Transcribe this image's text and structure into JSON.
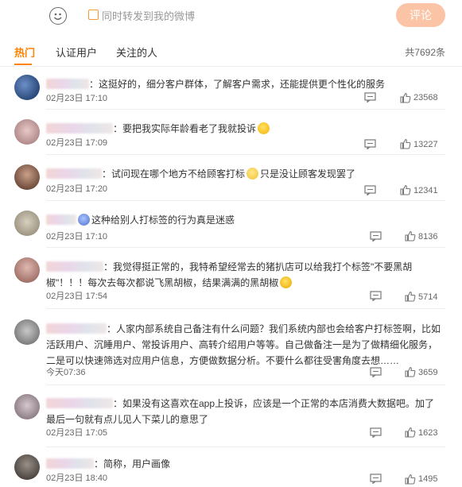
{
  "composer": {
    "emoji_icon": "smiley-icon",
    "repost_label": "同时转发到我的微博",
    "submit_label": "评论",
    "accent": "#ff8200",
    "submit_color": "#fbc4a6"
  },
  "tabs": [
    {
      "label": "热门",
      "active": true
    },
    {
      "label": "认证用户",
      "active": false
    },
    {
      "label": "关注的人",
      "active": false
    }
  ],
  "total_label": "共7692条",
  "comments": [
    {
      "name": "",
      "text": "：这挺好的，细分客户群体，了解客户需求，还能提供更个性化的服务",
      "time": "02月23日 17:10",
      "likes": "23568"
    },
    {
      "name": "",
      "text": "：要把我实际年龄看老了我就投诉",
      "time": "02月23日 17:09",
      "likes": "13227",
      "emoji": "grin-emoji"
    },
    {
      "name": "",
      "text": "：试问现在哪个地方不给顾客打标",
      "text_after": "只是没让顾客发现罢了",
      "time": "02月23日 17:20",
      "likes": "12341",
      "emoji": "grimace-emoji"
    },
    {
      "name": "",
      "text": "这种给别人打标签的行为真是迷惑",
      "time": "02月23日 17:10",
      "likes": "8136",
      "emoji": "think-emoji"
    },
    {
      "name": "",
      "text": "：我觉得挺正常的，我特希望经常去的猪扒店可以给我打个标签\"不要黑胡椒\"！！！每次去每次都说飞黑胡椒，结果满满的黑胡椒",
      "time": "02月23日 17:54",
      "likes": "5714",
      "emoji": "cry-emoji"
    },
    {
      "name": "",
      "text": "：人家内部系统自己备注有什么问题？我们系统内部也会给客户打标签啊，比如活跃用户、沉睡用户、常投诉用户、高转介绍用户等等。自己做备注一是为了做精细化服务，二是可以快速筛选对应用户信息，方便做数据分析。不要什么都往受害角度去想……",
      "time": "今天07:36",
      "likes": "3659"
    },
    {
      "name": "",
      "text": "：如果没有这喜欢在app上投诉，应该是一个正常的本店消费大数据吧。加了最后一句就有点儿见人下菜儿的意思了",
      "time": "02月23日 17:05",
      "likes": "1623"
    },
    {
      "name": "",
      "text": "：简称，用户画像",
      "time": "02月23日 18:40",
      "likes": "1495"
    }
  ]
}
